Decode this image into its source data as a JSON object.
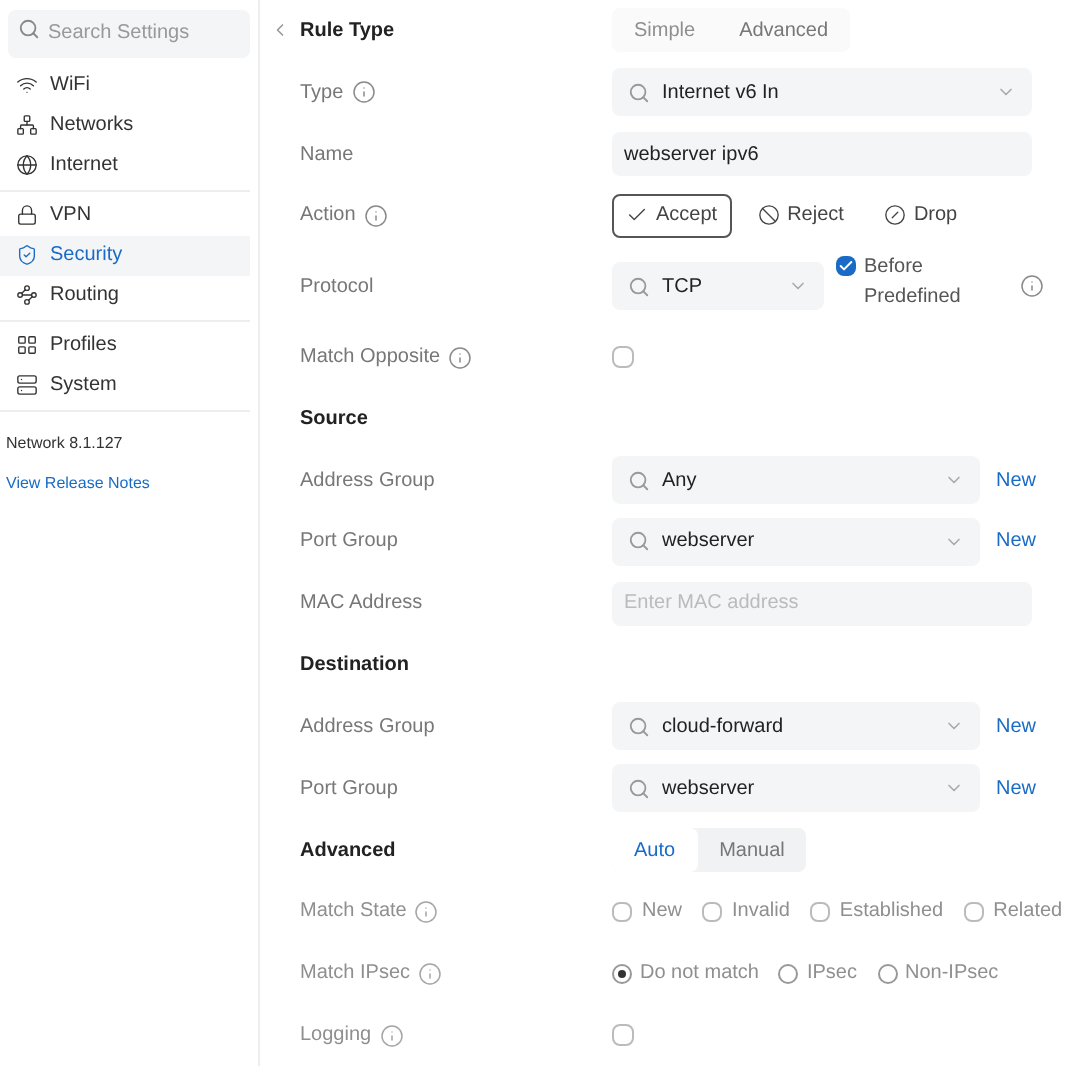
{
  "sidebar": {
    "search": {
      "placeholder": "Search Settings"
    },
    "groups": [
      [
        {
          "label": "WiFi",
          "selected": false
        },
        {
          "label": "Networks",
          "selected": false
        },
        {
          "label": "Internet",
          "selected": false
        }
      ],
      [
        {
          "label": "VPN",
          "selected": false
        },
        {
          "label": "Security",
          "selected": true
        },
        {
          "label": "Routing",
          "selected": false
        }
      ],
      [
        {
          "label": "Profiles",
          "selected": false
        },
        {
          "label": "System",
          "selected": false
        }
      ]
    ],
    "version": "Network 8.1.127",
    "release_notes": "View Release Notes"
  },
  "form": {
    "rows": [
      {
        "kind": "heading",
        "label": "Rule Type",
        "disabled": true,
        "tabs": [
          {
            "label": "Simple",
            "selected": false
          },
          {
            "label": "Advanced",
            "selected": true
          }
        ]
      },
      {
        "kind": "select",
        "label": "Type",
        "info": true,
        "disabled": false,
        "value": "Internet v6 In"
      },
      {
        "kind": "text",
        "label": "Name",
        "info": false,
        "disabled": false,
        "value": "webserver ipv6"
      },
      {
        "kind": "actions",
        "label": "Action",
        "info": true,
        "disabled": false,
        "options": [
          {
            "label": "Accept",
            "selected": true
          },
          {
            "label": "Reject",
            "selected": false
          },
          {
            "label": "Drop",
            "selected": false
          }
        ]
      },
      {
        "kind": "protocol",
        "label": "Protocol",
        "info": false,
        "disabled": false,
        "value": "TCP",
        "checkbox": {
          "label": "Before Predefined",
          "checked": true
        }
      },
      {
        "kind": "checkbox",
        "label": "Match Opposite",
        "info": true,
        "disabled": false,
        "checked": false
      },
      {
        "kind": "heading",
        "label": "Source"
      },
      {
        "kind": "select",
        "label": "Address Group",
        "info": false,
        "disabled": false,
        "value": "Any",
        "link": "New"
      },
      {
        "kind": "select",
        "label": "Port Group",
        "info": false,
        "disabled": false,
        "value": "webserver",
        "link": "New"
      },
      {
        "kind": "text",
        "label": "MAC Address",
        "info": false,
        "disabled": false,
        "placeholder": "Enter MAC address"
      },
      {
        "kind": "heading",
        "label": "Destination"
      },
      {
        "kind": "select",
        "label": "Address Group",
        "info": false,
        "disabled": false,
        "value": "cloud-forward",
        "link": "New"
      },
      {
        "kind": "select",
        "label": "Port Group",
        "info": false,
        "disabled": false,
        "value": "webserver",
        "link": "New"
      },
      {
        "kind": "heading",
        "label": "Advanced",
        "disabled": false,
        "tabs": [
          {
            "label": "Auto",
            "selected": true
          },
          {
            "label": "Manual",
            "selected": false
          }
        ]
      },
      {
        "kind": "checkgroup",
        "label": "Match State",
        "info": true,
        "disabled": true,
        "options": [
          {
            "label": "New",
            "checked": false
          },
          {
            "label": "Invalid",
            "checked": false
          },
          {
            "label": "Established",
            "checked": false
          },
          {
            "label": "Related",
            "checked": false
          }
        ]
      },
      {
        "kind": "radiogroup",
        "label": "Match IPsec",
        "info": true,
        "disabled": true,
        "options": [
          {
            "label": "Do not match",
            "selected": true
          },
          {
            "label": "IPsec",
            "selected": false
          },
          {
            "label": "Non-IPsec",
            "selected": false
          }
        ]
      },
      {
        "kind": "checkbox",
        "label": "Logging",
        "info": true,
        "disabled": true,
        "checked": false
      }
    ]
  }
}
